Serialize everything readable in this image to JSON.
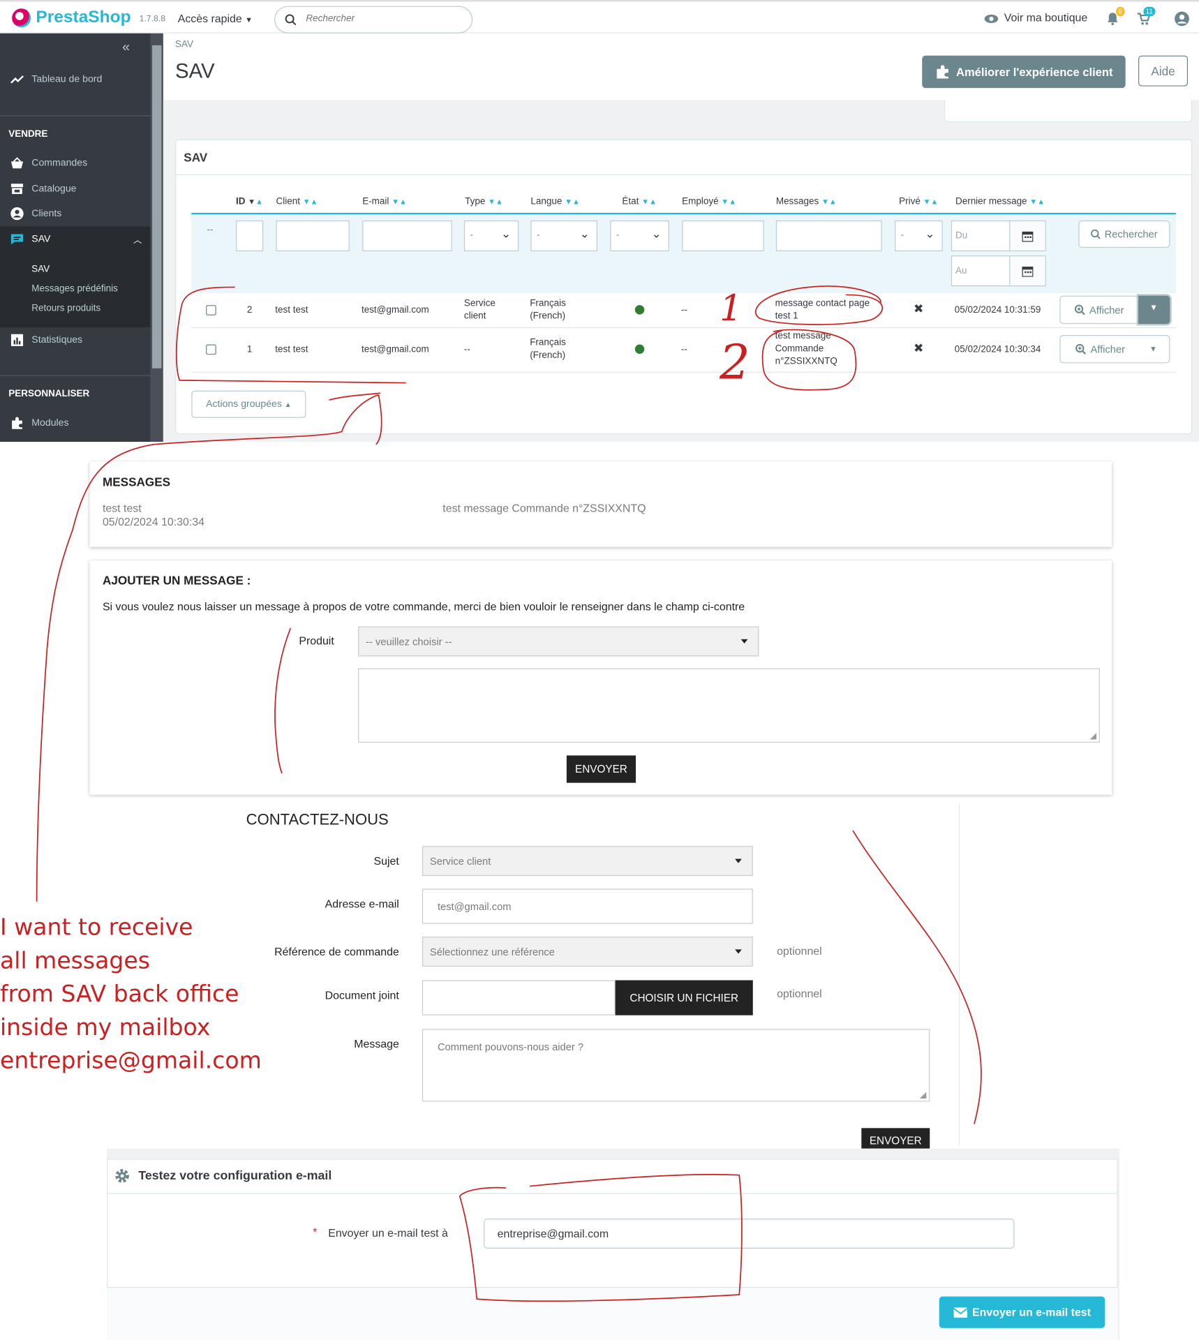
{
  "topbar": {
    "logo": "PrestaShop",
    "version": "1.7.8.8",
    "quick_access": "Accès rapide",
    "search_placeholder": "Rechercher",
    "view_shop": "Voir ma boutique",
    "notif_count": "8",
    "cart_count": "11"
  },
  "sidebar": {
    "dashboard": "Tableau de bord",
    "section_sell": "VENDRE",
    "items": [
      "Commandes",
      "Catalogue",
      "Clients",
      "SAV"
    ],
    "sub_items": [
      "SAV",
      "Messages prédéfinis",
      "Retours produits"
    ],
    "stats": "Statistiques",
    "section_custom": "PERSONNALISER",
    "modules": "Modules"
  },
  "header": {
    "breadcrumb": "SAV",
    "title": "SAV",
    "improve_button": "Améliorer l'expérience client",
    "help_button": "Aide"
  },
  "list": {
    "panel_title": "SAV",
    "columns": [
      "ID",
      "Client",
      "E-mail",
      "Type",
      "Langue",
      "État",
      "Employé",
      "Messages",
      "Privé",
      "Dernier message"
    ],
    "filter_placeholders": {
      "from": "Du",
      "to": "Au",
      "dash": "--",
      "select": "-"
    },
    "search_button": "Rechercher",
    "rows": [
      {
        "id": "2",
        "client": "test test",
        "email": "test@gmail.com",
        "type": "Service client",
        "lang": "Français (French)",
        "employee": "--",
        "message": "message contact page test 1",
        "last": "05/02/2024 10:31:59",
        "action": "Afficher"
      },
      {
        "id": "1",
        "client": "test test",
        "email": "test@gmail.com",
        "type": "--",
        "lang": "Français (French)",
        "employee": "--",
        "message": "test message Commande n°ZSSIXXNTQ",
        "last": "05/02/2024 10:30:34",
        "action": "Afficher"
      }
    ],
    "bulk_actions": "Actions groupées"
  },
  "messages": {
    "title": "MESSAGES",
    "author": "test test",
    "date": "05/02/2024 10:30:34",
    "body": "test message Commande n°ZSSIXXNTQ"
  },
  "add_message": {
    "title": "AJOUTER UN MESSAGE :",
    "intro": "Si vous voulez nous laisser un message à propos de votre commande, merci de bien vouloir le renseigner dans le champ ci-contre",
    "product_label": "Produit",
    "product_placeholder": "-- veuillez choisir --",
    "send": "ENVOYER"
  },
  "contact": {
    "title": "CONTACTEZ-NOUS",
    "subject_label": "Sujet",
    "subject_value": "Service client",
    "email_label": "Adresse e-mail",
    "email_value": "test@gmail.com",
    "order_label": "Référence de commande",
    "order_value": "Sélectionnez une référence",
    "optional": "optionnel",
    "attach_label": "Document joint",
    "attach_button": "CHOISIR UN FICHIER",
    "message_label": "Message",
    "message_placeholder": "Comment pouvons-nous aider ?",
    "send": "ENVOYER"
  },
  "email_test": {
    "title": "Testez votre configuration e-mail",
    "label": "Envoyer un e-mail test à",
    "value": "entreprise@gmail.com",
    "send": "Envoyer un e-mail test"
  },
  "note": {
    "lines": [
      "I want to receive",
      "all messages",
      "from SAV back office",
      "inside my mailbox",
      "entreprise@gmail.com"
    ]
  },
  "annotations": {
    "one": "1",
    "two": "2"
  },
  "colors": {
    "accent": "#25b9d7",
    "sidebar": "#363a41",
    "annotation": "#cc1f1f",
    "status_green": "#2e7d32"
  }
}
